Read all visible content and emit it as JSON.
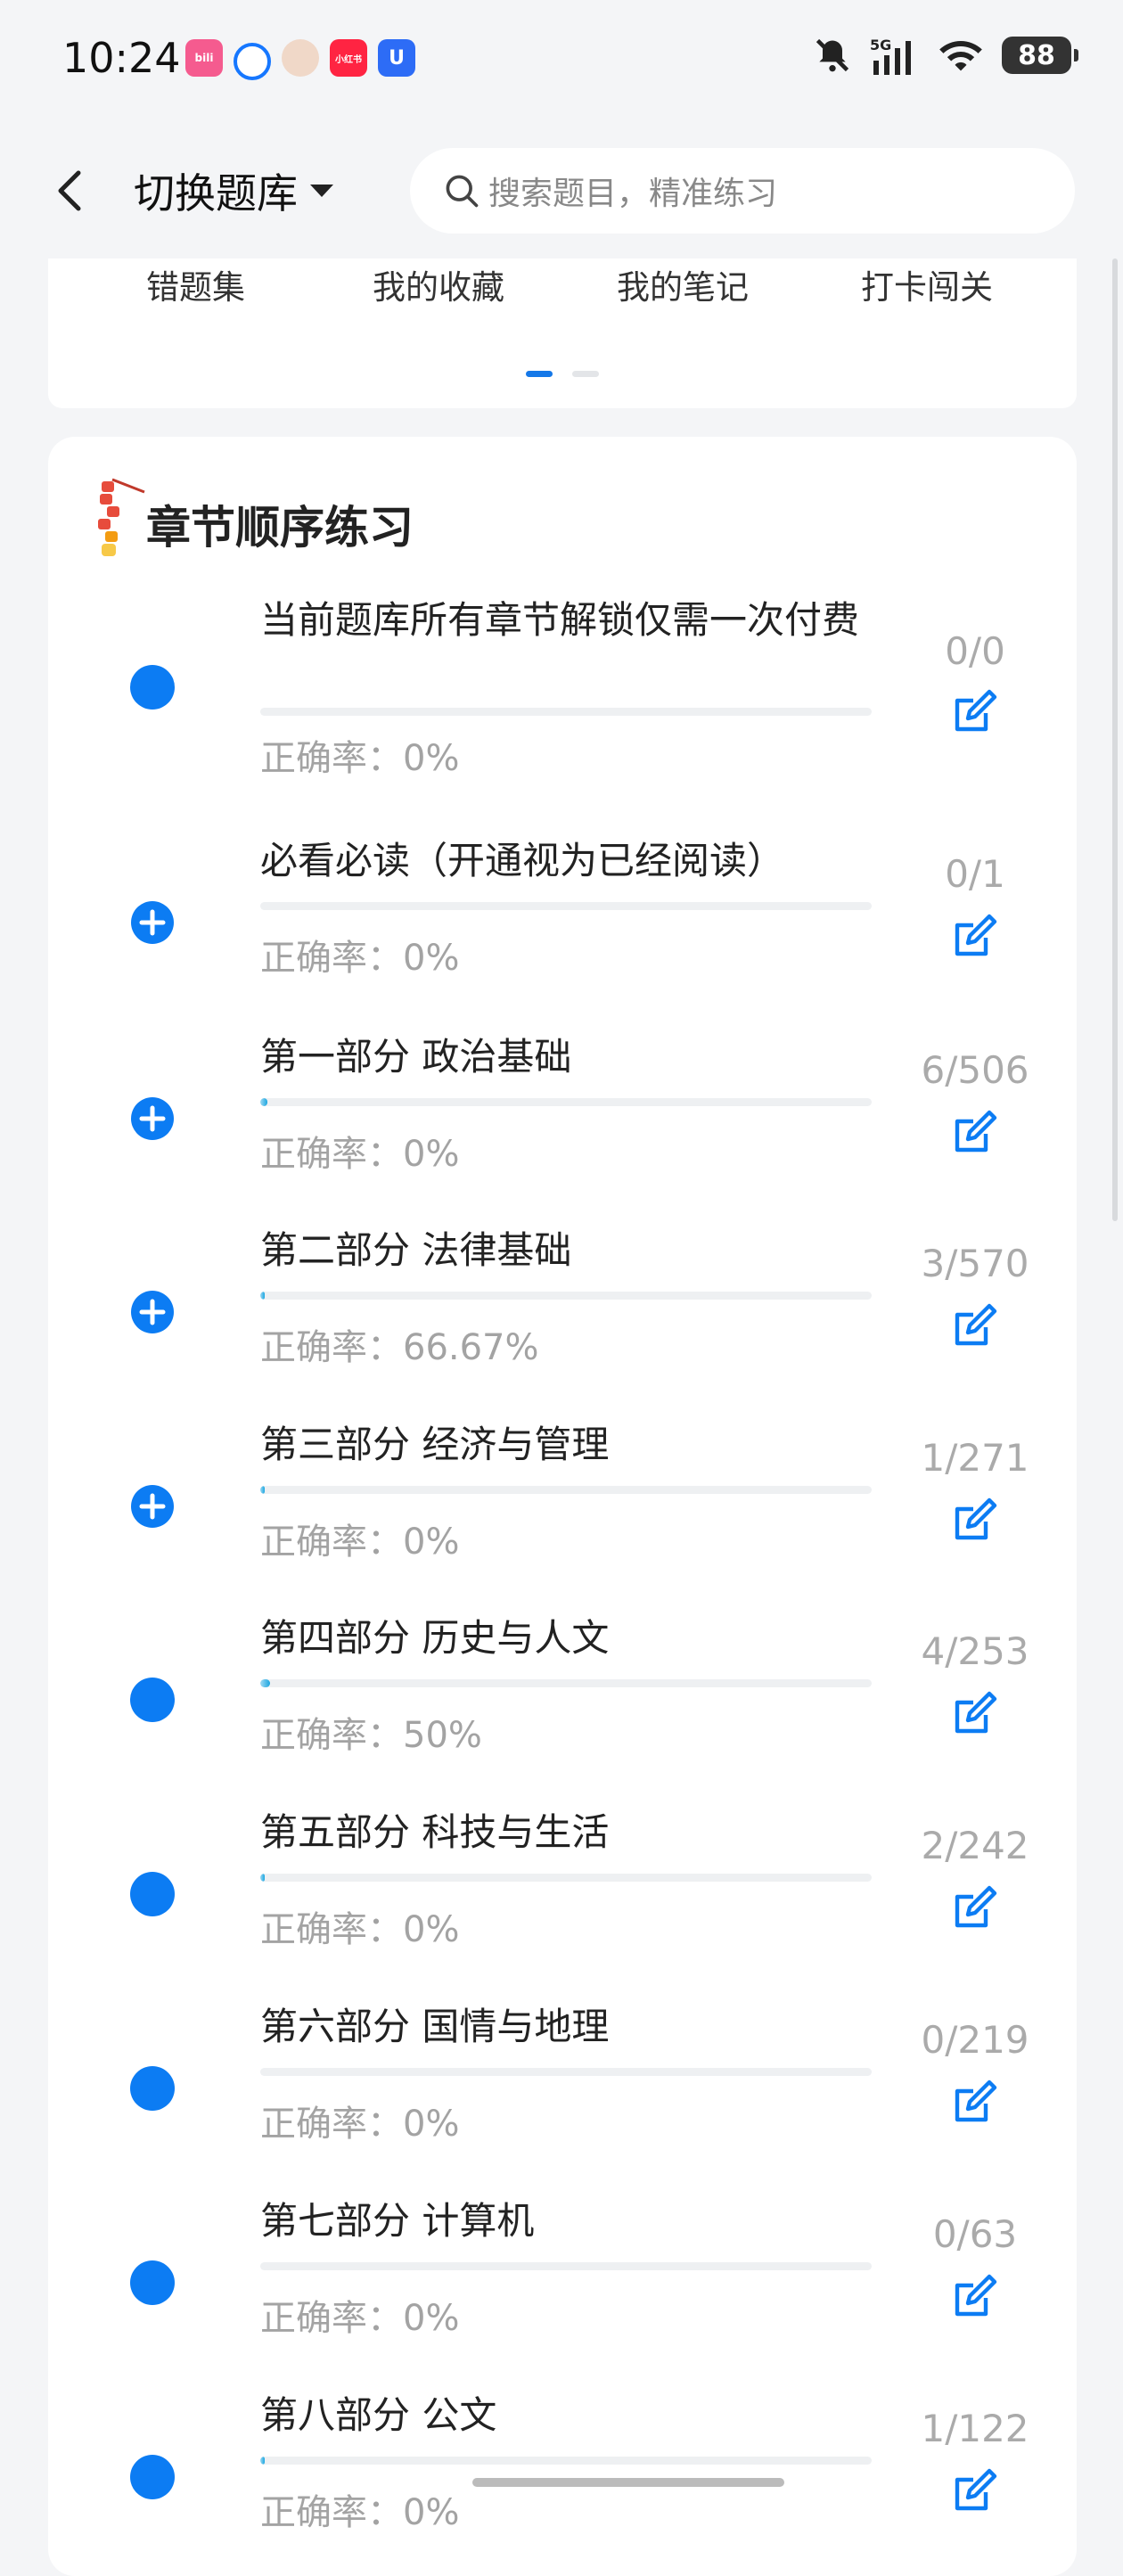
{
  "status_bar": {
    "time": "10:24",
    "network": "5G",
    "battery": "88",
    "app_icons": [
      "bilibili",
      "message",
      "avatar",
      "小红书",
      "U"
    ]
  },
  "header": {
    "switch_bank_label": "切换题库",
    "search_placeholder": "搜索题目，精准练习"
  },
  "tools": {
    "items": [
      "错题集",
      "我的收藏",
      "我的笔记",
      "打卡闯关"
    ]
  },
  "section": {
    "title": "章节顺序练习"
  },
  "accuracy_prefix": "正确率：",
  "chapters": [
    {
      "title": "当前题库所有章节解锁仅需一次付费",
      "accuracy": "正确率：0%",
      "count": "0/0",
      "progress": 0,
      "icon": "dot"
    },
    {
      "title": "必看必读（开通视为已经阅读）",
      "accuracy": "正确率：0%",
      "count": "0/1",
      "progress": 0,
      "icon": "plus"
    },
    {
      "title": "第一部分 政治基础",
      "accuracy": "正确率：0%",
      "count": "6/506",
      "progress": 0.012,
      "icon": "plus"
    },
    {
      "title": "第二部分 法律基础",
      "accuracy": "正确率：66.67%",
      "count": "3/570",
      "progress": 0.005,
      "icon": "plus"
    },
    {
      "title": "第三部分 经济与管理",
      "accuracy": "正确率：0%",
      "count": "1/271",
      "progress": 0.004,
      "icon": "plus"
    },
    {
      "title": "第四部分 历史与人文",
      "accuracy": "正确率：50%",
      "count": "4/253",
      "progress": 0.016,
      "icon": "dot"
    },
    {
      "title": "第五部分 科技与生活",
      "accuracy": "正确率：0%",
      "count": "2/242",
      "progress": 0.008,
      "icon": "dot"
    },
    {
      "title": "第六部分 国情与地理",
      "accuracy": "正确率：0%",
      "count": "0/219",
      "progress": 0,
      "icon": "dot"
    },
    {
      "title": "第七部分 计算机",
      "accuracy": "正确率：0%",
      "count": "0/63",
      "progress": 0,
      "icon": "dot"
    },
    {
      "title": "第八部分 公文",
      "accuracy": "正确率：0%",
      "count": "1/122",
      "progress": 0.008,
      "icon": "dot"
    }
  ],
  "colors": {
    "accent": "#0c7cf3",
    "muted": "#a3a3a3"
  }
}
